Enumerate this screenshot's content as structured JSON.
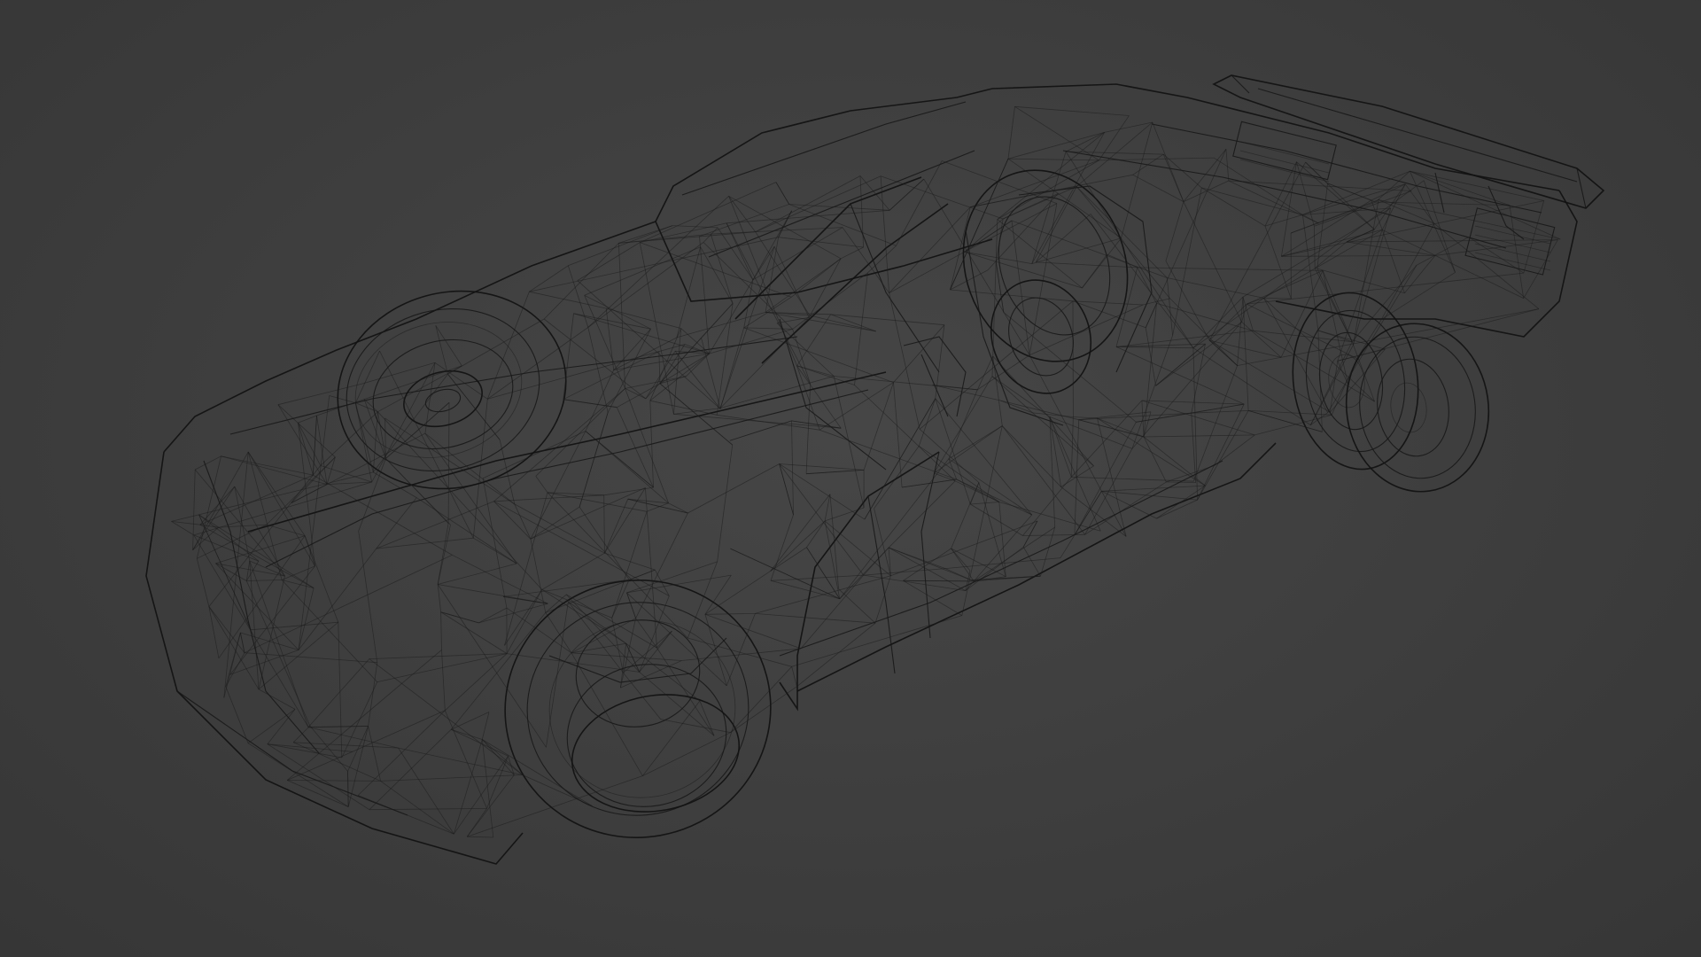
{
  "viewport": {
    "background_color": "#3d3d3d",
    "wire_color": "#161616",
    "shading_mode": "wireframe",
    "object": "race-car-wireframe-model"
  }
}
